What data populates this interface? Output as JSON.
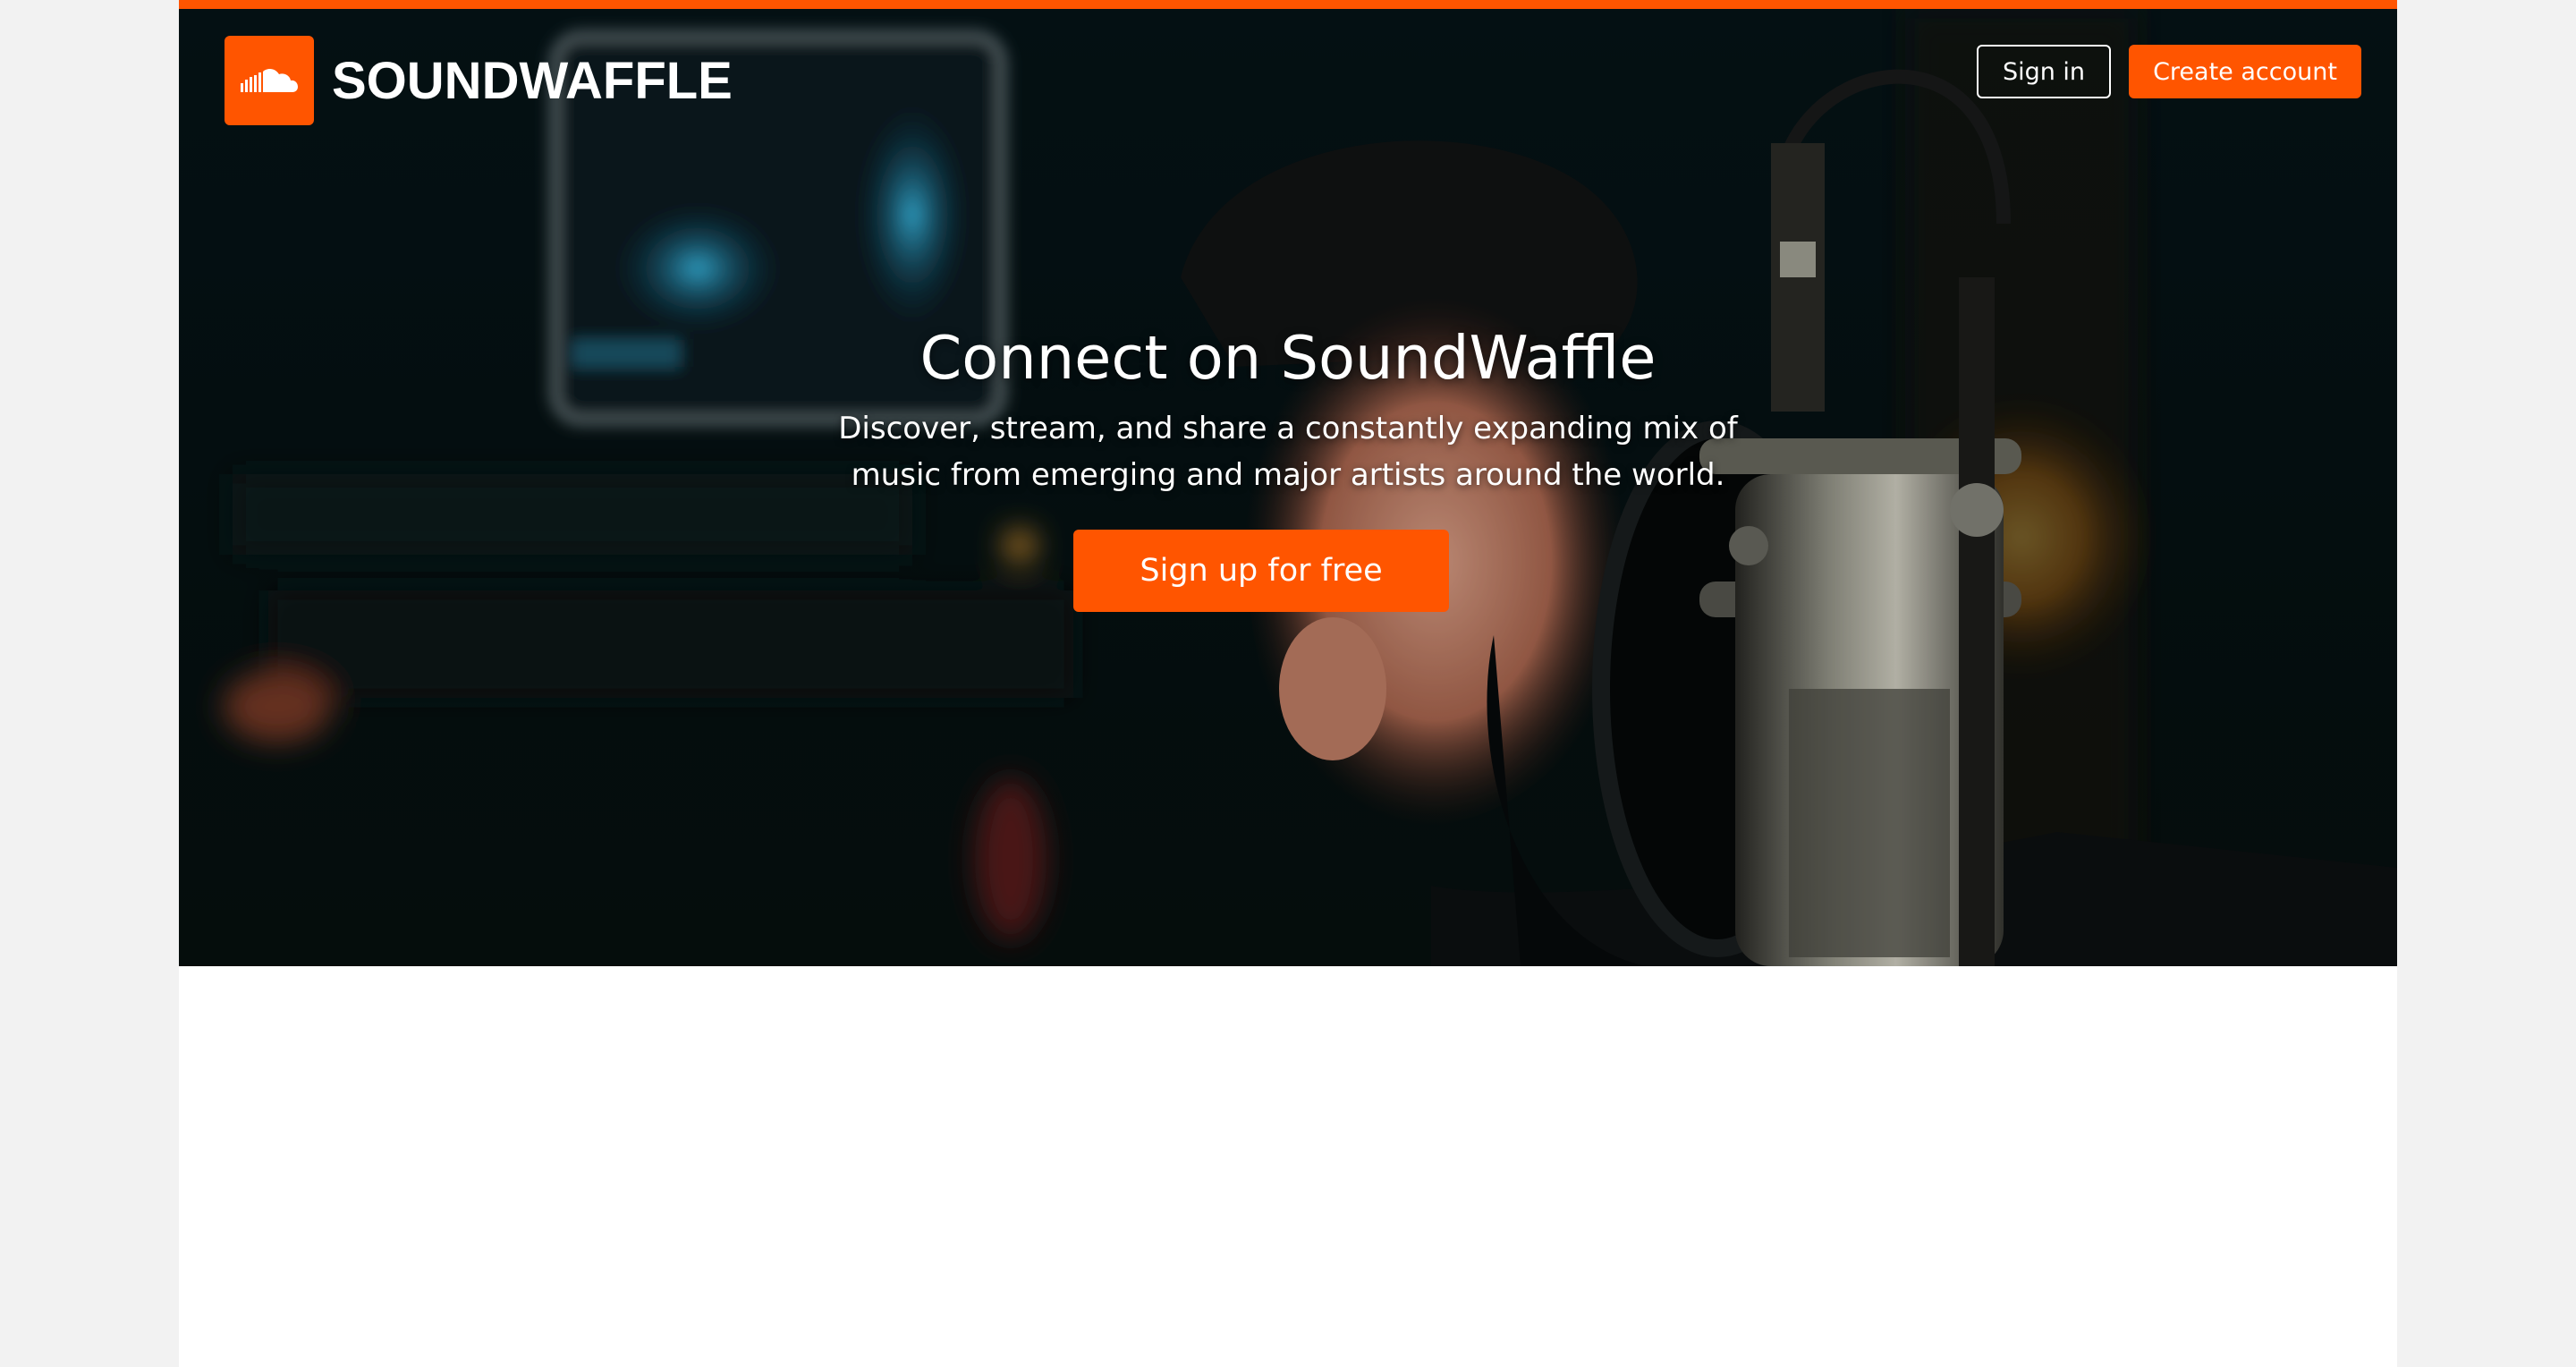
{
  "brand": {
    "name": "SOUNDWAFFLE",
    "logo_icon": "cloud-icon",
    "accent_color": "#ff5500"
  },
  "header": {
    "sign_in_label": "Sign in",
    "create_account_label": "Create account"
  },
  "hero": {
    "title": "Connect on SoundWaffle",
    "subtitle": "Discover, stream, and share a constantly expanding mix of music from emerging and major artists around the world.",
    "cta_label": "Sign up for free",
    "background_image": "recording-studio-microphone-photo"
  }
}
